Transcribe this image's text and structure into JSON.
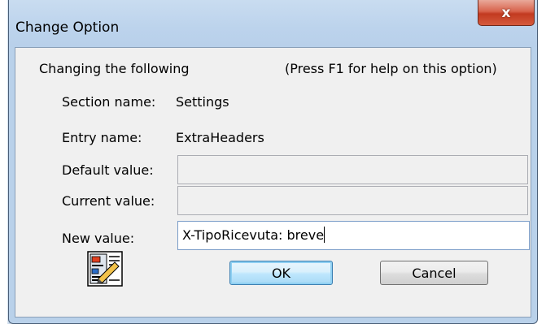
{
  "window": {
    "title": "Change Option",
    "close_glyph": "x"
  },
  "header": {
    "changing": "Changing the following",
    "help_hint": "(Press F1 for help on this option)"
  },
  "fields": {
    "section_label": "Section name:",
    "section_value": "Settings",
    "entry_label": "Entry name:",
    "entry_value": "ExtraHeaders",
    "default_label": "Default value:",
    "default_value": "",
    "current_label": "Current value:",
    "current_value": "",
    "new_label": "New value:",
    "new_value": "X-TipoRicevuta: breve"
  },
  "buttons": {
    "ok": "OK",
    "cancel": "Cancel"
  },
  "icons": {
    "help": "document-edit-icon",
    "close": "close-icon"
  },
  "colors": {
    "frame": "#b9d1ea",
    "close_button": "#c8432a",
    "ok_border": "#3c7fb1"
  }
}
